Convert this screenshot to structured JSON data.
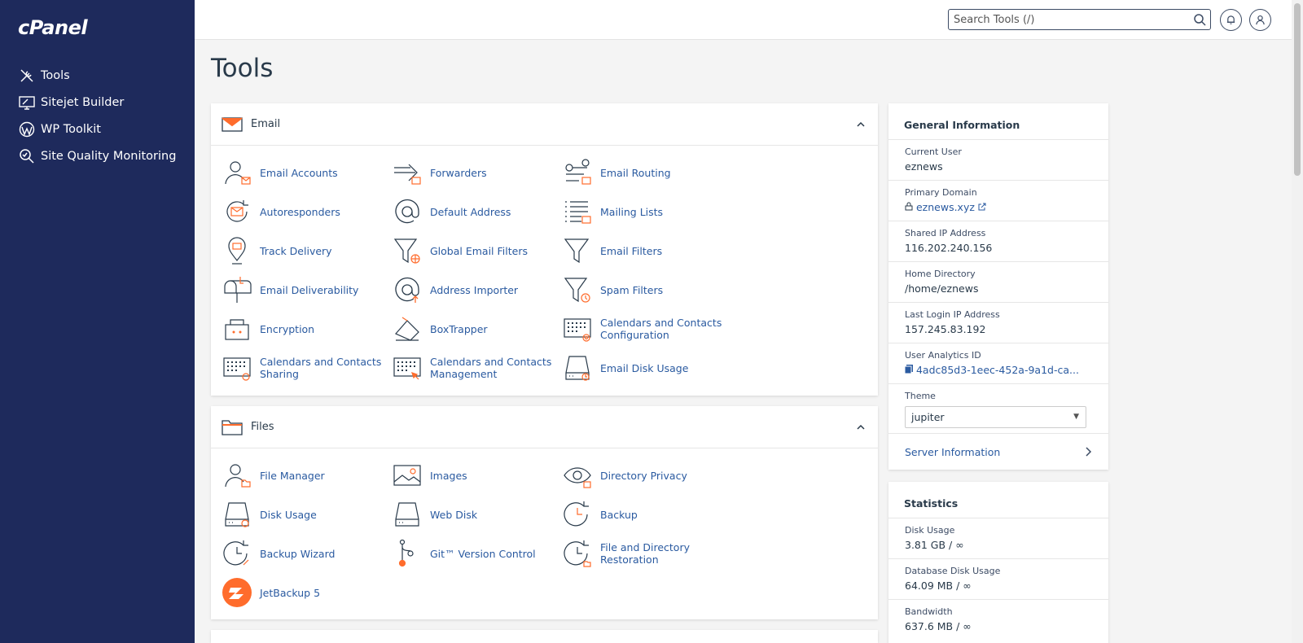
{
  "app": {
    "logo": "cPanel"
  },
  "sidebar": {
    "items": [
      {
        "label": "Tools",
        "icon": "tools-icon"
      },
      {
        "label": "Sitejet Builder",
        "icon": "sitejet-icon"
      },
      {
        "label": "WP Toolkit",
        "icon": "wordpress-icon"
      },
      {
        "label": "Site Quality Monitoring",
        "icon": "site-quality-icon"
      }
    ]
  },
  "header": {
    "search_placeholder": "Search Tools (/)"
  },
  "main": {
    "title": "Tools",
    "email": {
      "title": "Email",
      "tools": [
        "Email Accounts",
        "Forwarders",
        "Email Routing",
        "Autoresponders",
        "Default Address",
        "Mailing Lists",
        "Track Delivery",
        "Global Email Filters",
        "Email Filters",
        "Email Deliverability",
        "Address Importer",
        "Spam Filters",
        "Encryption",
        "BoxTrapper",
        "Calendars and Contacts Configuration",
        "Calendars and Contacts Sharing",
        "Calendars and Contacts Management",
        "Email Disk Usage"
      ]
    },
    "files": {
      "title": "Files",
      "tools": [
        "File Manager",
        "Images",
        "Directory Privacy",
        "Disk Usage",
        "Web Disk",
        "Backup",
        "Backup Wizard",
        "Git™ Version Control",
        "File and Directory Restoration",
        "JetBackup 5"
      ]
    }
  },
  "general_info": {
    "title": "General Information",
    "current_user_label": "Current User",
    "current_user": "eznews",
    "primary_domain_label": "Primary Domain",
    "primary_domain": "eznews.xyz",
    "shared_ip_label": "Shared IP Address",
    "shared_ip": "116.202.240.156",
    "home_dir_label": "Home Directory",
    "home_dir": "/home/eznews",
    "last_login_label": "Last Login IP Address",
    "last_login": "157.245.83.192",
    "analytics_label": "User Analytics ID",
    "analytics_id": "4adc85d3-1eec-452a-9a1d-ca...",
    "theme_label": "Theme",
    "theme": "jupiter",
    "server_info": "Server Information"
  },
  "statistics": {
    "title": "Statistics",
    "disk_usage_label": "Disk Usage",
    "disk_usage": "3.81 GB / ∞",
    "db_disk_label": "Database Disk Usage",
    "db_disk": "64.09 MB / ∞",
    "bandwidth_label": "Bandwidth",
    "bandwidth": "637.6 MB / ∞"
  },
  "colors": {
    "sidebar": "#1e2a5c",
    "accent": "#ff6c2c",
    "link": "#2a5aa0"
  }
}
